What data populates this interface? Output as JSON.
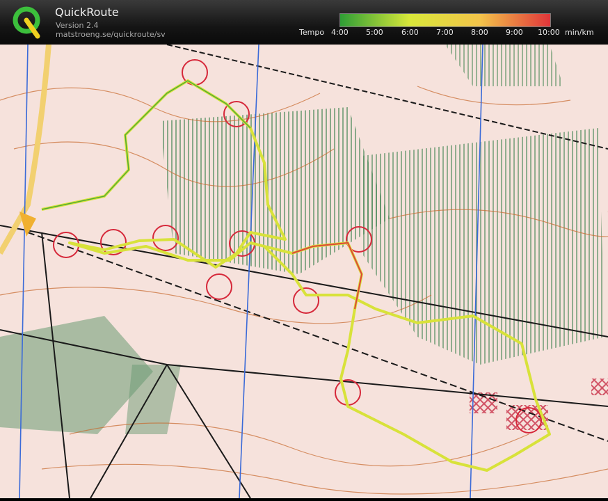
{
  "header": {
    "title": "QuickRoute",
    "version": "Version 2.4",
    "url": "matstroeng.se/quickroute/sv",
    "tempo_label": "Tempo",
    "unit": "min/km",
    "ticks": [
      "4:00",
      "5:00",
      "6:00",
      "7:00",
      "8:00",
      "9:00",
      "10:00"
    ],
    "scale_colors": [
      "#2f9e36",
      "#d9e83a",
      "#f2c34a",
      "#e0353a"
    ]
  },
  "logo": {
    "letter": "Q",
    "colors": [
      "#3cbf3c",
      "#f0d020"
    ]
  },
  "map": {
    "colors": {
      "paper": "#f6e2dc",
      "contour": "#c86a2e",
      "vegetation_green": "#4c8a5a",
      "out_of_bounds": "#c83048",
      "north_lines": "#3a6ad8",
      "control_circles": "#d6283a",
      "track": "#d8e23a"
    }
  }
}
